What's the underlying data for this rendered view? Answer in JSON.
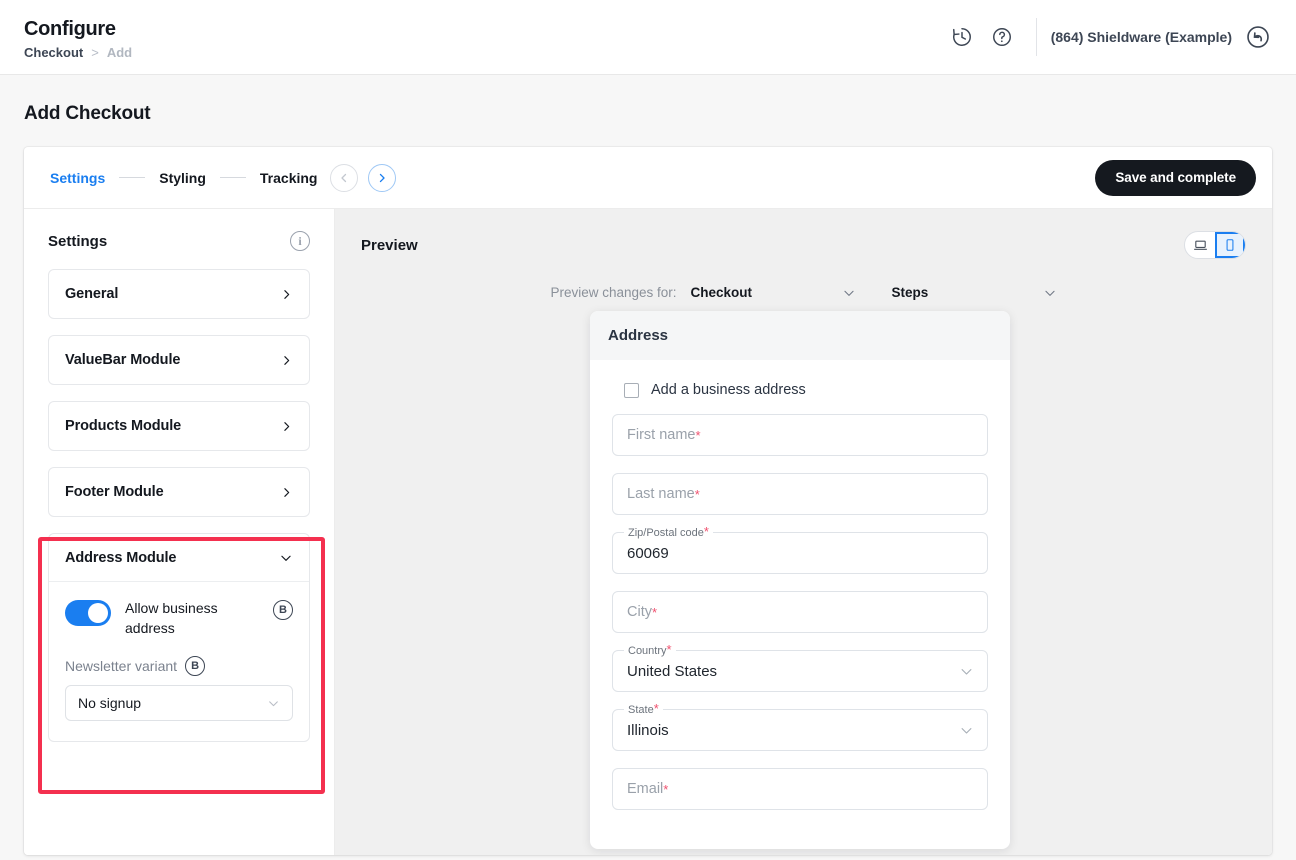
{
  "header": {
    "title": "Configure",
    "breadcrumb": {
      "first": "Checkout",
      "separator": ">",
      "last": "Add"
    },
    "history_icon": "history-clock-icon",
    "help_icon": "help-question-icon",
    "account_name": "(864) Shieldware (Example)",
    "back_icon": "undo-arrow-icon"
  },
  "page": {
    "title": "Add Checkout"
  },
  "tabs": [
    {
      "label": "Settings",
      "active": true
    },
    {
      "label": "Styling",
      "active": false
    },
    {
      "label": "Tracking",
      "active": false
    }
  ],
  "nav": {
    "prev_icon": "chevron-left-icon",
    "next_icon": "chevron-right-icon"
  },
  "toolbar": {
    "save_label": "Save and complete"
  },
  "sidebar": {
    "title": "Settings",
    "info_icon": "info-icon",
    "modules": [
      {
        "label": "General",
        "expanded": false
      },
      {
        "label": "ValueBar Module",
        "expanded": false
      },
      {
        "label": "Products Module",
        "expanded": false
      },
      {
        "label": "Footer Module",
        "expanded": false
      }
    ],
    "address_module": {
      "label": "Address Module",
      "toggle": {
        "label": "Allow business address",
        "on": true,
        "badge": "B"
      },
      "newsletter": {
        "label": "Newsletter variant",
        "badge": "B",
        "value": "No signup",
        "options": [
          "No signup"
        ]
      }
    },
    "highlight_color": "#f4304f"
  },
  "preview": {
    "title": "Preview",
    "devices": [
      {
        "name": "laptop-icon",
        "active": false
      },
      {
        "name": "mobile-icon",
        "active": true
      }
    ],
    "controls_label": "Preview changes for:",
    "selects": [
      {
        "value": "Checkout"
      },
      {
        "value": "Steps"
      }
    ],
    "card": {
      "header": "Address",
      "business_checkbox": {
        "label": "Add a business address",
        "checked": false
      },
      "fields": [
        {
          "type": "placeholder",
          "placeholder": "First name",
          "required": true
        },
        {
          "type": "placeholder",
          "placeholder": "Last name",
          "required": true
        },
        {
          "type": "filled",
          "label": "Zip/Postal code",
          "value": "60069",
          "required": true
        },
        {
          "type": "placeholder",
          "placeholder": "City",
          "required": true
        },
        {
          "type": "select",
          "label": "Country",
          "value": "United States",
          "required": true
        },
        {
          "type": "select",
          "label": "State",
          "value": "Illinois",
          "required": true
        },
        {
          "type": "placeholder",
          "placeholder": "Email",
          "required": true
        }
      ]
    }
  },
  "colors": {
    "accent": "#1a7ef0",
    "dark": "#15191f",
    "highlight": "#f4304f",
    "required": "#f0506e"
  }
}
